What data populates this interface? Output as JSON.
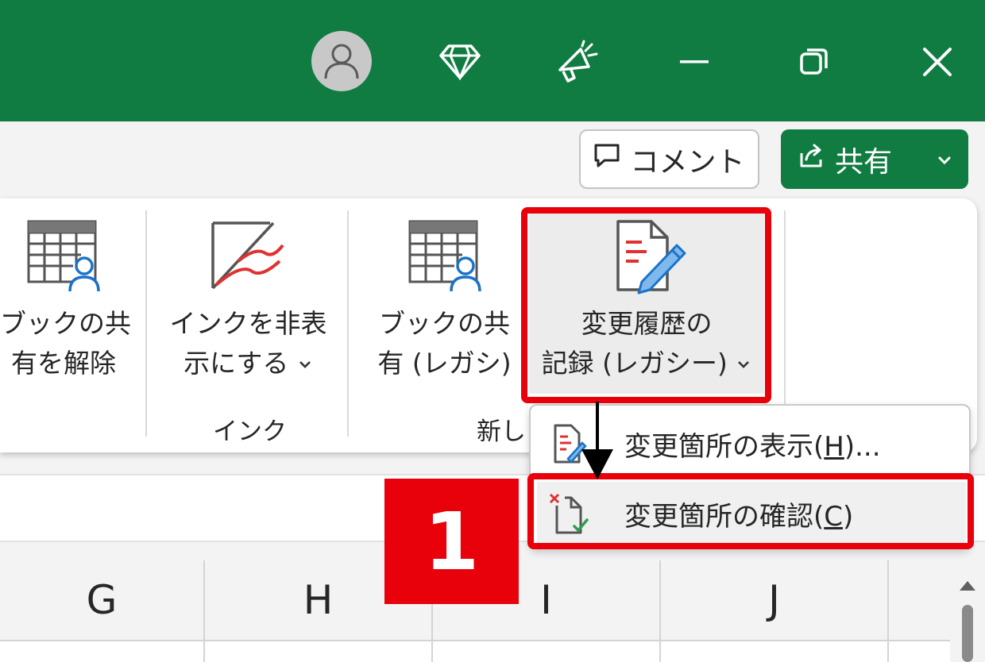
{
  "titlebar": {
    "icons": [
      "account-avatar-icon",
      "premium-diamond-icon",
      "feedback-megaphone-icon",
      "minimize-icon",
      "restore-icon",
      "close-icon"
    ]
  },
  "toolbar": {
    "comment_label": "コメント",
    "share_label": "共有"
  },
  "ribbon": {
    "buttons": [
      {
        "line1": "ブックの共",
        "line2": "有を解除",
        "icon": "unshare-workbook-icon"
      },
      {
        "line1": "インクを非表",
        "line2": "示にする",
        "icon": "hide-ink-icon",
        "dropdown": true
      },
      {
        "line1": "ブックの共",
        "line2": "有 (レガシ)",
        "icon": "share-workbook-legacy-icon"
      },
      {
        "line1": "変更履歴の",
        "line2": "記録 (レガシー)",
        "icon": "track-changes-icon",
        "dropdown": true
      }
    ],
    "groups": {
      "ink": "インク",
      "new_partial": "新し"
    }
  },
  "dropdown_menu": {
    "items": [
      {
        "label_before": "変更箇所の表示(",
        "accel": "H",
        "label_after": ")...",
        "icon": "highlight-changes-icon"
      },
      {
        "label_before": "変更箇所の確認(",
        "accel": "C",
        "label_after": ")",
        "icon": "accept-reject-changes-icon"
      }
    ]
  },
  "columns": [
    "G",
    "H",
    "I",
    "J"
  ],
  "annotation": {
    "step_number": "1",
    "highlight_color": "#e8000b"
  },
  "colors": {
    "titlebar": "#107c41",
    "share_button": "#107c41"
  }
}
